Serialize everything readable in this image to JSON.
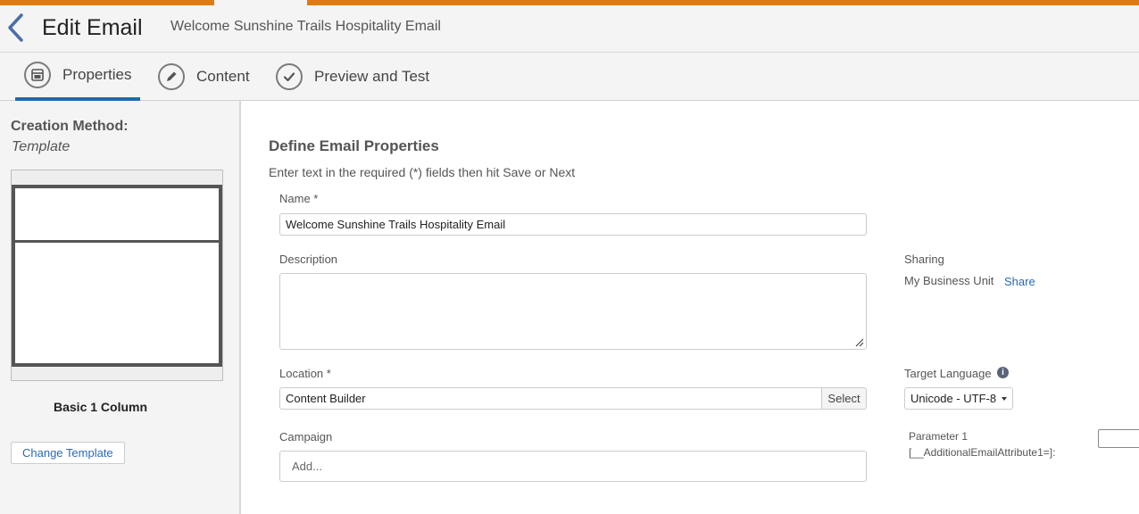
{
  "header": {
    "title": "Edit Email",
    "subtitle": "Welcome Sunshine Trails Hospitality Email"
  },
  "tabs": [
    {
      "label": "Properties",
      "icon": "layout-icon",
      "active": true
    },
    {
      "label": "Content",
      "icon": "pencil-icon",
      "active": false
    },
    {
      "label": "Preview and Test",
      "icon": "checkmark-icon",
      "active": false
    }
  ],
  "sidebar": {
    "creation_method_label": "Creation Method:",
    "creation_method_value": "Template",
    "template_name": "Basic 1 Column",
    "change_template_label": "Change Template"
  },
  "form": {
    "title": "Define Email Properties",
    "description": "Enter text in the required (*) fields then hit Save or Next",
    "name_label": "Name *",
    "name_value": "Welcome Sunshine Trails Hospitality Email",
    "description_label": "Description",
    "description_value": "",
    "location_label": "Location *",
    "location_value": "Content Builder",
    "select_label": "Select",
    "campaign_label": "Campaign",
    "campaign_placeholder": "Add...",
    "sharing_label": "Sharing",
    "sharing_value": "My Business Unit",
    "share_link": "Share",
    "target_language_label": "Target Language",
    "target_language_value": "Unicode - UTF-8",
    "parameter_label": "Parameter 1",
    "parameter_attribute": "[__AdditionalEmailAttribute1=]:",
    "parameter_value": ""
  },
  "colors": {
    "accent_orange": "#e07b13",
    "tab_active": "#1d6ab3",
    "link": "#2a6bb3"
  }
}
